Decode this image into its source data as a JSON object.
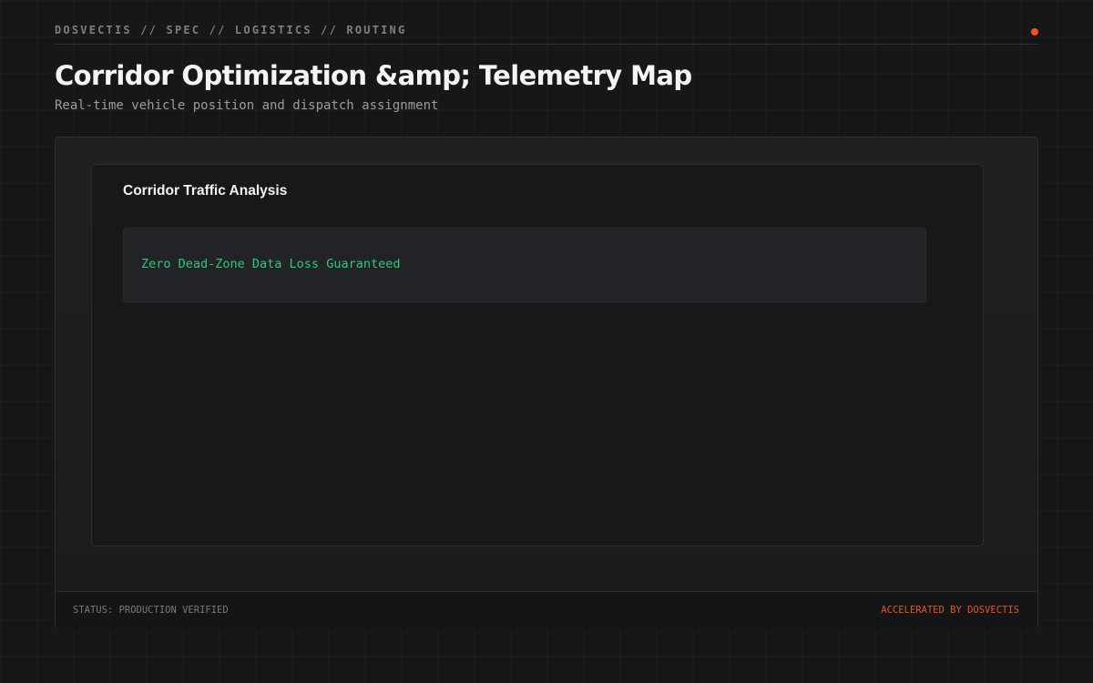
{
  "header": {
    "breadcrumb": "DOSVECTIS // SPEC // LOGISTICS // ROUTING",
    "status_dot_color": "#ff4d1a"
  },
  "page": {
    "title": "Corridor Optimization &amp; Telemetry Map",
    "subtitle": "Real-time vehicle position and dispatch assignment"
  },
  "card": {
    "title": "Corridor Traffic Analysis",
    "code_text": "Zero Dead-Zone Data Loss Guaranteed",
    "code_color": "#2fc97a"
  },
  "footer": {
    "status": "STATUS: PRODUCTION VERIFIED",
    "brand": "ACCELERATED BY DOSVECTIS",
    "brand_color": "#e8541f"
  }
}
